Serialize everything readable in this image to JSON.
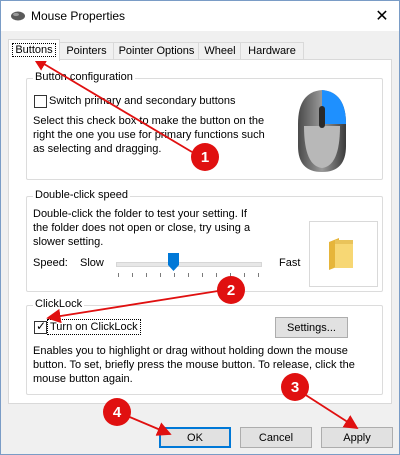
{
  "window": {
    "title": "Mouse Properties",
    "close_glyph": "✕"
  },
  "tabs": [
    {
      "label": "Buttons",
      "active": true
    },
    {
      "label": "Pointers"
    },
    {
      "label": "Pointer Options"
    },
    {
      "label": "Wheel"
    },
    {
      "label": "Hardware"
    }
  ],
  "button_config": {
    "title": "Button configuration",
    "checkbox_label": "Switch primary and secondary buttons",
    "checked": false,
    "description": "Select this check box to make the button on the right the one you use for primary functions such as selecting and dragging."
  },
  "double_click": {
    "title": "Double-click speed",
    "description": "Double-click the folder to test your setting. If the folder does not open or close, try using a slower setting.",
    "speed_label": "Speed:",
    "slow_label": "Slow",
    "fast_label": "Fast",
    "speed_level": 0.45
  },
  "clicklock": {
    "title": "ClickLock",
    "checkbox_label": "Turn on ClickLock",
    "checked": true,
    "settings_label": "Settings...",
    "description": "Enables you to highlight or drag without holding down the mouse button. To set, briefly press the mouse button. To release, click the mouse button again."
  },
  "footer": {
    "ok": "OK",
    "cancel": "Cancel",
    "apply": "Apply"
  },
  "annotations": {
    "m1": "1",
    "m2": "2",
    "m3": "3",
    "m4": "4"
  },
  "colors": {
    "annotation_red": "#e01010",
    "accent_blue": "#0078d7",
    "mouse_blue": "#1e90ff"
  }
}
